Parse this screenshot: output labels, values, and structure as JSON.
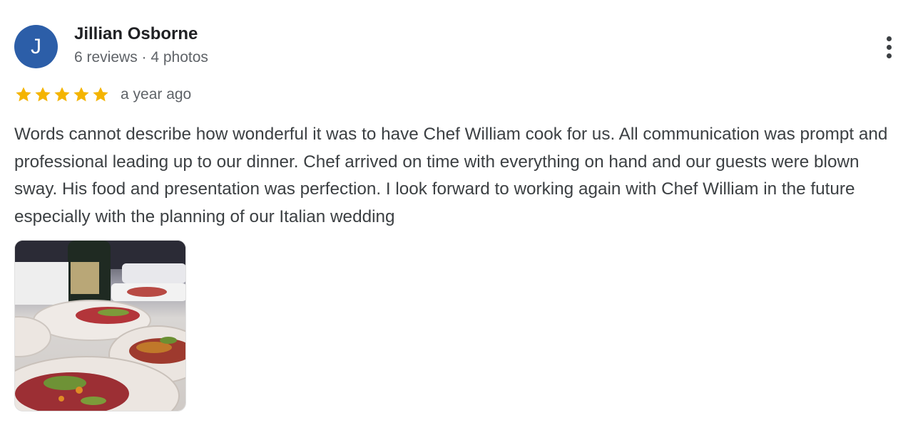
{
  "reviewer": {
    "initial": "J",
    "name": "Jillian Osborne",
    "meta": "6 reviews · 4 photos"
  },
  "rating": {
    "stars": 5,
    "max": 5,
    "date": "a year ago"
  },
  "review": {
    "text": "Words cannot describe how wonderful it was to have Chef William cook for us. All communication was prompt and professional leading up to our dinner. Chef arrived on time with everything on hand and our guests were blown sway. His food and presentation was perfection. I look forward to working again with Chef William in the future especially with the planning of our Italian wedding"
  },
  "photo": {
    "subject": "plated food thumbnail"
  },
  "icons": {
    "avatar": "user-initial-avatar",
    "star": "star-icon",
    "more": "more-vert-icon"
  },
  "colors": {
    "avatar_bg": "#2c5ea8",
    "star": "#f4b400",
    "text": "#3c4043",
    "meta": "#5f6368"
  }
}
